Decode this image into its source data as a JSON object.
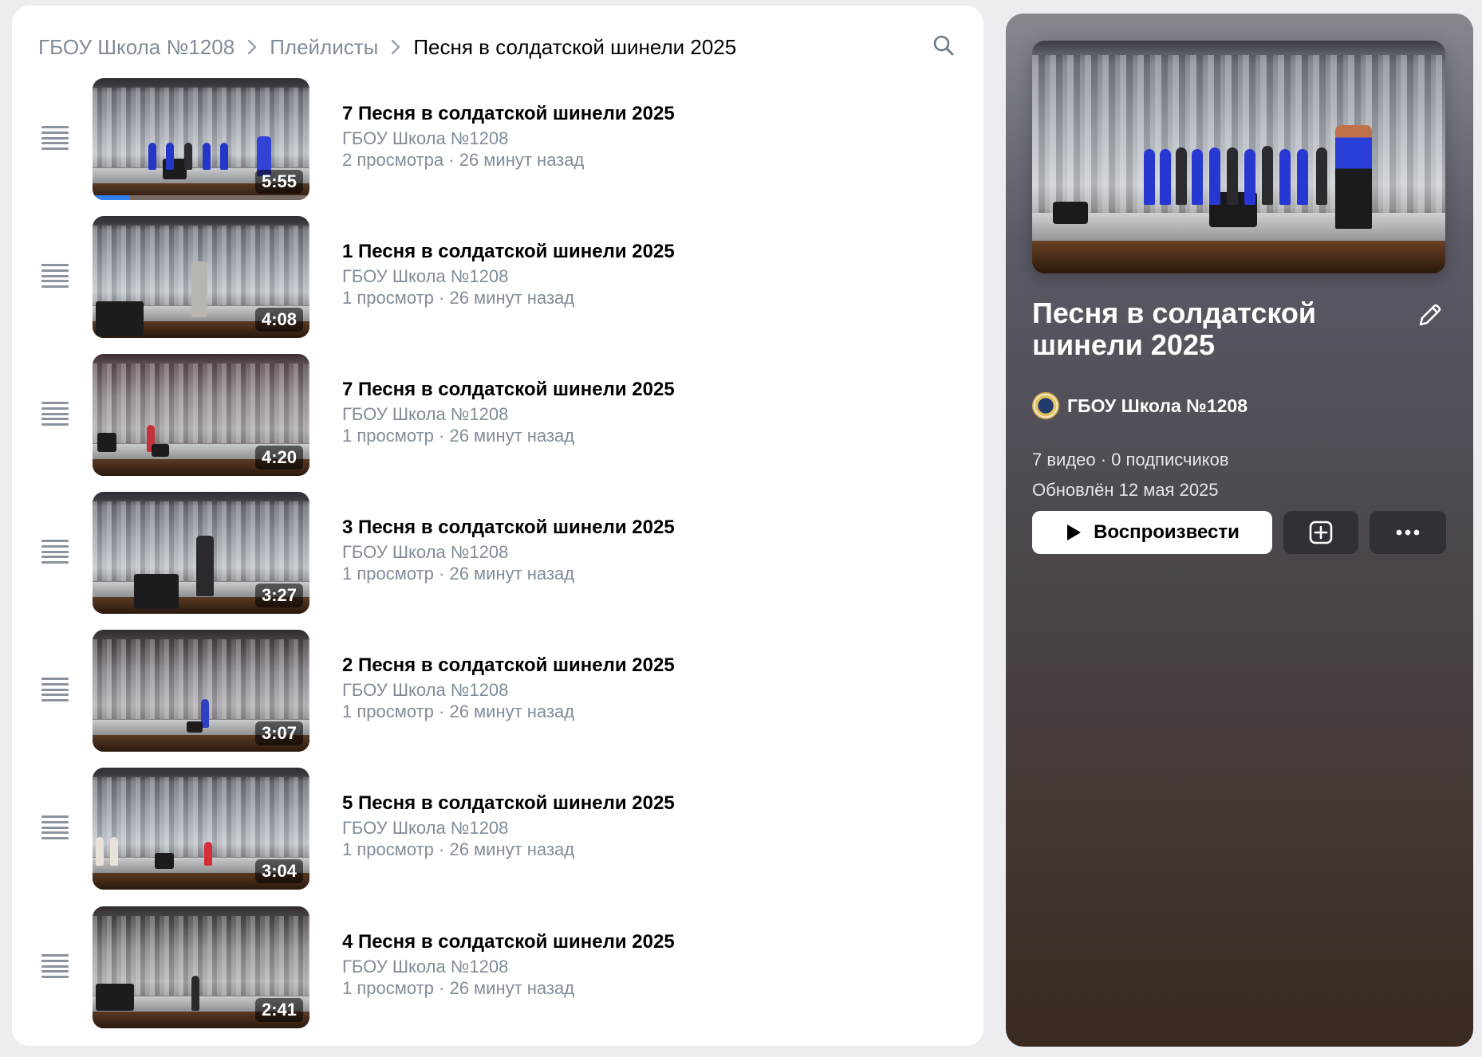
{
  "breadcrumb": {
    "items": [
      "ГБОУ Школа №1208",
      "Плейлисты",
      "Песня в солдатской шинели 2025"
    ]
  },
  "videos": [
    {
      "title": "7 Песня в солдатской шинели 2025",
      "channel": "ГБОУ Школа №1208",
      "stats": "2 просмотра · 26 минут назад",
      "duration": "5:55",
      "progress": 0.17
    },
    {
      "title": "1 Песня в солдатской шинели 2025",
      "channel": "ГБОУ Школа №1208",
      "stats": "1 просмотр · 26 минут назад",
      "duration": "4:08"
    },
    {
      "title": "7 Песня в солдатской шинели 2025",
      "channel": "ГБОУ Школа №1208",
      "stats": "1 просмотр · 26 минут назад",
      "duration": "4:20"
    },
    {
      "title": "3 Песня в солдатской шинели 2025",
      "channel": "ГБОУ Школа №1208",
      "stats": "1 просмотр · 26 минут назад",
      "duration": "3:27"
    },
    {
      "title": "2 Песня в солдатской шинели 2025",
      "channel": "ГБОУ Школа №1208",
      "stats": "1 просмотр · 26 минут назад",
      "duration": "3:07"
    },
    {
      "title": "5 Песня в солдатской шинели 2025",
      "channel": "ГБОУ Школа №1208",
      "stats": "1 просмотр · 26 минут назад",
      "duration": "3:04"
    },
    {
      "title": "4 Песня в солдатской шинели 2025",
      "channel": "ГБОУ Школа №1208",
      "stats": "1 просмотр · 26 минут назад",
      "duration": "2:41"
    }
  ],
  "playlist": {
    "title": "Песня в солдатской шинели 2025",
    "owner": "ГБОУ Школа №1208",
    "counts": "7 видео · 0 подписчиков",
    "updated": "Обновлён 12 мая 2025",
    "play_label": "Воспроизвести"
  },
  "icons": {
    "search": "search-icon",
    "drag": "drag-handle-icon",
    "chevron": "chevron-right-icon",
    "edit": "pencil-icon",
    "play": "play-icon",
    "add": "add-square-icon",
    "more": "more-horizontal-icon"
  },
  "colors": {
    "accent_progress": "#2f80ed",
    "muted_text": "#818c99",
    "page_bg": "#ebedf0"
  }
}
